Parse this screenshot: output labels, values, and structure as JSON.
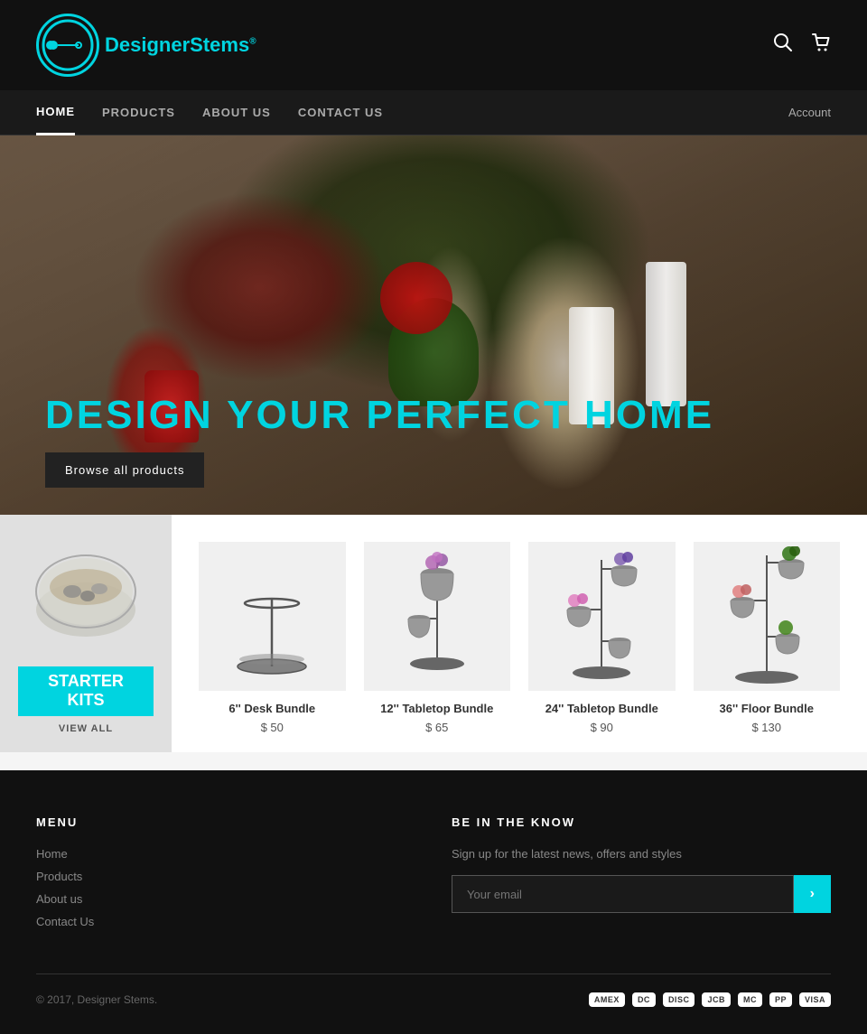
{
  "brand": {
    "name": "DesignerStems",
    "name_part1": "Designer",
    "name_part2": "Stems",
    "trademark": "®"
  },
  "header": {
    "search_label": "Search",
    "cart_label": "Cart"
  },
  "nav": {
    "items": [
      {
        "id": "home",
        "label": "HOME",
        "active": true
      },
      {
        "id": "products",
        "label": "PRODUCTS",
        "active": false
      },
      {
        "id": "about",
        "label": "ABOUT US",
        "active": false
      },
      {
        "id": "contact",
        "label": "CONTACT US",
        "active": false
      }
    ],
    "account_label": "Account"
  },
  "hero": {
    "title": "DESIGN YOUR PERFECT HOME",
    "cta_label": "Browse all products"
  },
  "starter_kits": {
    "label_line1": "STARTER",
    "label_line2": "KITS",
    "view_all": "VIEW ALL"
  },
  "products": [
    {
      "id": "desk-bundle",
      "name": "6'' Desk Bundle",
      "price": "$ 50"
    },
    {
      "id": "tabletop-12",
      "name": "12'' Tabletop Bundle",
      "price": "$ 65"
    },
    {
      "id": "tabletop-24",
      "name": "24'' Tabletop Bundle",
      "price": "$ 90"
    },
    {
      "id": "floor-36",
      "name": "36'' Floor Bundle",
      "price": "$ 130"
    }
  ],
  "footer": {
    "menu_title": "MENU",
    "menu_items": [
      {
        "label": "Home",
        "id": "home"
      },
      {
        "label": "Products",
        "id": "products"
      },
      {
        "label": "About us",
        "id": "about"
      },
      {
        "label": "Contact Us",
        "id": "contact"
      }
    ],
    "newsletter_title": "BE IN THE KNOW",
    "newsletter_desc": "Sign up for the latest news, offers and styles",
    "newsletter_placeholder": "Your email",
    "newsletter_btn": "›",
    "copyright": "© 2017, Designer Stems.",
    "payment_icons": [
      "VISA",
      "MC",
      "PP",
      "DISC",
      "JCB",
      "DC",
      "AMEX"
    ]
  },
  "colors": {
    "accent": "#00d4e0",
    "dark_bg": "#111111",
    "nav_bg": "#1a1a1a"
  }
}
